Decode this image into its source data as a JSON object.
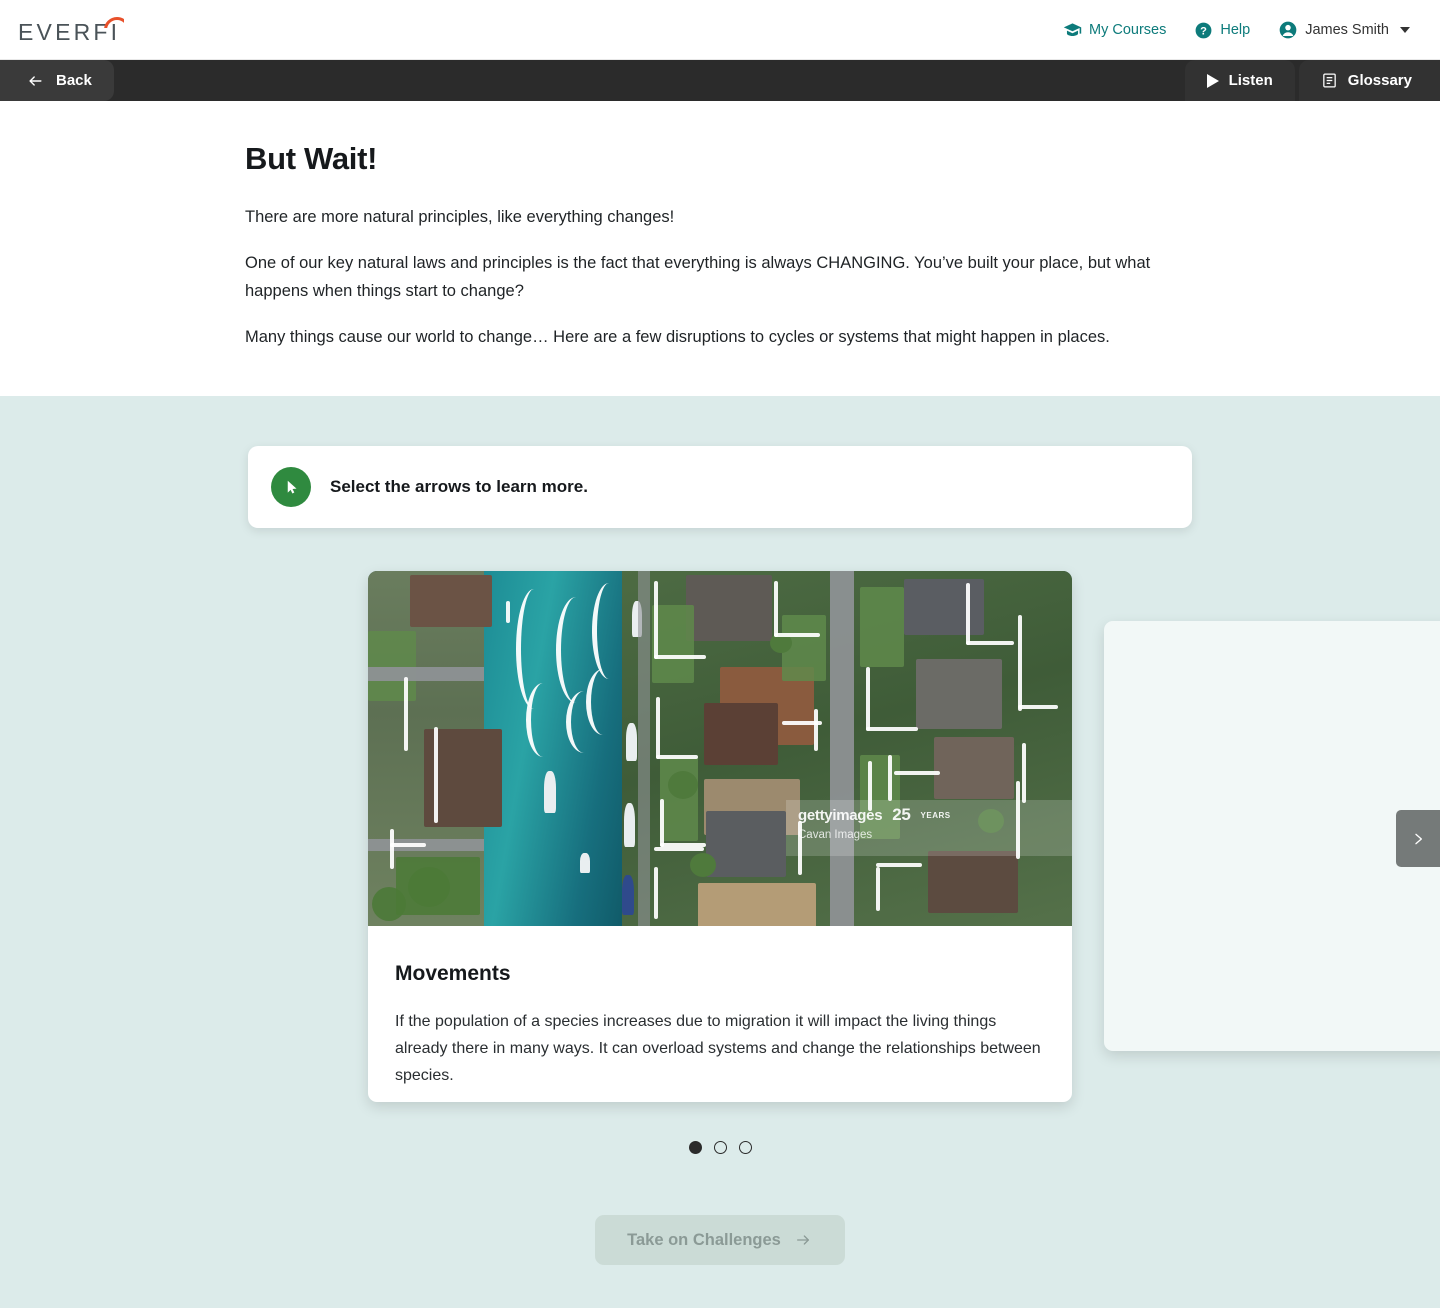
{
  "brand": {
    "logo_text": "EVERFI",
    "logo_accent_color": "#e8512b",
    "logo_color": "#4a5358"
  },
  "topnav": {
    "my_courses": "My Courses",
    "my_courses_icon": "graduation-cap-icon",
    "help": "Help",
    "help_icon": "question-circle-icon",
    "user_name": "James Smith",
    "user_icon": "user-circle-icon",
    "chevron_icon": "chevron-down-icon",
    "link_color": "#0d7b7b"
  },
  "subnav": {
    "back_label": "Back",
    "back_icon": "arrow-left-icon",
    "listen_label": "Listen",
    "listen_icon": "play-icon",
    "glossary_label": "Glossary",
    "glossary_icon": "book-icon",
    "background_color": "#2b2b2b"
  },
  "main": {
    "title": "But Wait!",
    "paragraphs": [
      "There are more natural principles, like everything changes!",
      "One of our key natural laws and principles is the fact that everything is always CHANGING. You’ve built your place, but what happens when things start to change?",
      "Many things cause our world to change… Here are a few disruptions to cycles or systems that might happen in places."
    ]
  },
  "callout": {
    "text": "Select the arrows to learn more.",
    "icon": "cursor-pointer-icon",
    "icon_bg_color": "#2f8a3f"
  },
  "carousel": {
    "background_color": "#dcebea",
    "card": {
      "title": "Movements",
      "description": "If the population of a species increases due to migration it will impact the living things already there in many ways. It can overload systems and change the relationships between species.",
      "image_alt": "Aerial view of a waterfront suburban neighborhood with canal and boats",
      "watermark_brand": "gettyimages",
      "watermark_years": "25",
      "watermark_years_label": "YEARS",
      "watermark_credit": "Cavan Images"
    },
    "next_arrow_icon": "chevron-right-icon",
    "dots": [
      {
        "index": 1,
        "active": true
      },
      {
        "index": 2,
        "active": false
      },
      {
        "index": 3,
        "active": false
      }
    ]
  },
  "footer": {
    "cta_label": "Take on Challenges",
    "cta_icon": "arrow-right-icon",
    "cta_disabled": true
  }
}
